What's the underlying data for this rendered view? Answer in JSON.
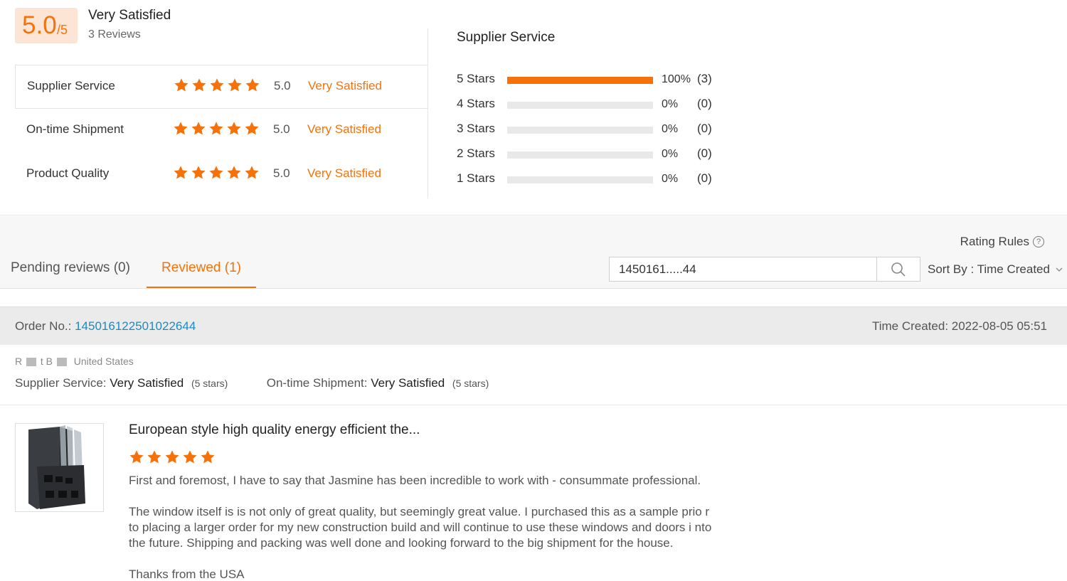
{
  "summary": {
    "score": "5.0",
    "score_max": "/5",
    "overall_label": "Very Satisfied",
    "review_count": "3 Reviews",
    "criteria": [
      {
        "name": "Supplier Service",
        "stars": 5,
        "score": "5.0",
        "label": "Very Satisfied"
      },
      {
        "name": "On-time Shipment",
        "stars": 5,
        "score": "5.0",
        "label": "Very Satisfied"
      },
      {
        "name": "Product Quality",
        "stars": 5,
        "score": "5.0",
        "label": "Very Satisfied"
      }
    ]
  },
  "distribution": {
    "title": "Supplier Service",
    "rows": [
      {
        "label": "5  Stars",
        "fraction": 1.0,
        "pct": "100%",
        "count": "(3)"
      },
      {
        "label": "4  Stars",
        "fraction": 0.0,
        "pct": "0%",
        "count": "(0)"
      },
      {
        "label": "3  Stars",
        "fraction": 0.0,
        "pct": "0%",
        "count": "(0)"
      },
      {
        "label": "2  Stars",
        "fraction": 0.0,
        "pct": "0%",
        "count": "(0)"
      },
      {
        "label": "1  Stars",
        "fraction": 0.0,
        "pct": "0%",
        "count": "(0)"
      }
    ]
  },
  "toolbar": {
    "rating_rules": "Rating Rules",
    "tabs": [
      {
        "label": "Pending reviews (0)"
      },
      {
        "label": "Reviewed (1)"
      }
    ],
    "search_value": "1450161.....44",
    "sort_label": "Sort By : Time Created"
  },
  "order": {
    "order_label": "Order No.:",
    "order_number": "145016122501022644",
    "time_created": "Time Created: 2022-08-05 05:51",
    "buyer_initials": "R",
    "buyer_mid": "t B",
    "buyer_country": "United States",
    "supplier_service_label": "Supplier Service:",
    "supplier_service_value": "Very Satisfied",
    "supplier_service_stars": "(5 stars)",
    "shipment_label": "On-time Shipment:",
    "shipment_value": "Very Satisfied",
    "shipment_stars": "(5 stars)"
  },
  "review": {
    "product_title": "European style high quality energy efficient the...",
    "stars": 5,
    "paragraphs": [
      "First and foremost, I have to say that Jasmine has been incredible to work with - consummate professional.",
      "The window itself is is not only of great quality, but seemingly great value. I purchased this as a sample prio r to placing a larger order for my new construction build and will continue to use these windows and doors i nto the future. Shipping and packing was well done and looking forward to the big shipment for the house.",
      "Thanks from the USA"
    ]
  },
  "colors": {
    "accent": "#f5720a",
    "link": "#1a8bc6"
  },
  "icons": {
    "star": "star-icon",
    "search": "search-icon",
    "help": "help-circle-icon",
    "chevron": "chevron-down-icon"
  }
}
